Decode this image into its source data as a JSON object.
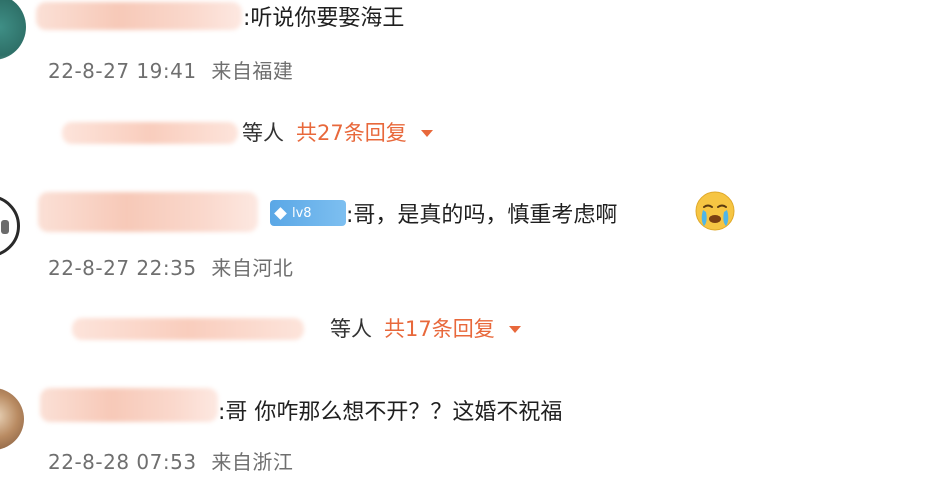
{
  "comments": [
    {
      "text": ":听说你要娶海王",
      "time": "22-8-27 19:41",
      "location": "来自福建",
      "reply_suffix": "等人",
      "reply_count": "共27条回复"
    },
    {
      "badge_label": "lv8",
      "text": ":哥，是真的吗，慎重考虑啊",
      "emoji_icon": "crying-face-icon",
      "time": "22-8-27 22:35",
      "location": "来自河北",
      "reply_suffix": "等人",
      "reply_count": "共17条回复"
    },
    {
      "text": ":哥 你咋那么想不开？？这婚不祝福",
      "time": "22-8-28 07:53",
      "location": "来自浙江"
    }
  ],
  "colors": {
    "reply_count": "#e8683b",
    "meta_text": "#6f6f6f",
    "badge": "#5aa7e6"
  }
}
